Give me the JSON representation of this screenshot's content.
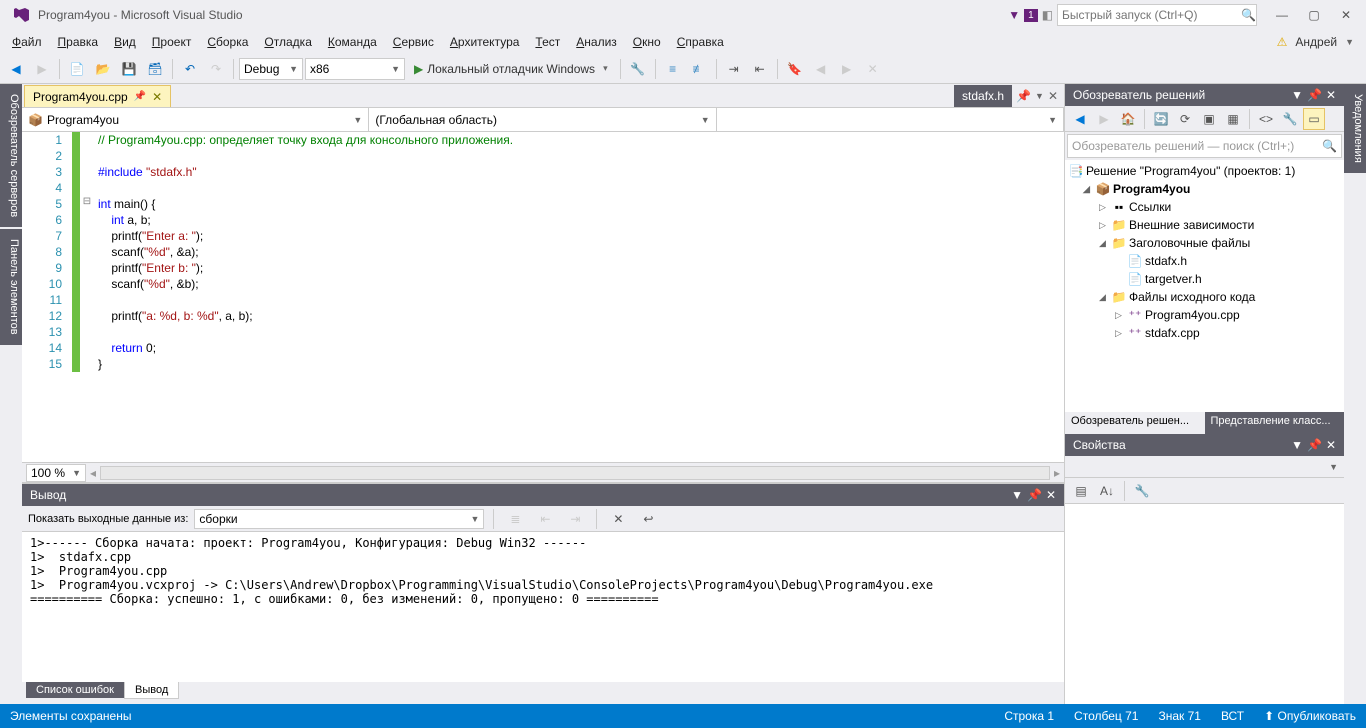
{
  "title": "Program4you - Microsoft Visual Studio",
  "notifCount": "1",
  "quickLaunch": "Быстрый запуск (Ctrl+Q)",
  "user": "Андрей",
  "menu": [
    "Файл",
    "Правка",
    "Вид",
    "Проект",
    "Сборка",
    "Отладка",
    "Команда",
    "Сервис",
    "Архитектура",
    "Тест",
    "Анализ",
    "Окно",
    "Справка"
  ],
  "toolbar": {
    "config": "Debug",
    "platform": "x86",
    "run": "Локальный отладчик Windows"
  },
  "leftStrips": [
    "Обозреватель серверов",
    "Панель элементов"
  ],
  "rightStrip": "Уведомления",
  "docTabs": {
    "active": "Program4you.cpp",
    "other": "stdafx.h"
  },
  "navCombos": {
    "left": "Program4you",
    "right": "(Глобальная область)"
  },
  "code": {
    "lines": [
      {
        "n": 1,
        "type": "cmt",
        "text": "// Program4you.cpp: определяет точку входа для консольного приложения."
      },
      {
        "n": 2,
        "type": "blank",
        "text": ""
      },
      {
        "n": 3,
        "type": "inc",
        "kw": "#include ",
        "str": "\"stdafx.h\""
      },
      {
        "n": 4,
        "type": "blank",
        "text": ""
      },
      {
        "n": 5,
        "type": "main",
        "pre": "",
        "kw1": "int",
        "mid": " main() {"
      },
      {
        "n": 6,
        "type": "decl",
        "indent": "    ",
        "kw": "int",
        "rest": " a, b;"
      },
      {
        "n": 7,
        "type": "call",
        "indent": "    ",
        "fn": "printf(",
        "str": "\"Enter a: \"",
        "end": ");"
      },
      {
        "n": 8,
        "type": "call",
        "indent": "    ",
        "fn": "scanf(",
        "str": "\"%d\"",
        "end": ", &a);"
      },
      {
        "n": 9,
        "type": "call",
        "indent": "    ",
        "fn": "printf(",
        "str": "\"Enter b: \"",
        "end": ");"
      },
      {
        "n": 10,
        "type": "call",
        "indent": "    ",
        "fn": "scanf(",
        "str": "\"%d\"",
        "end": ", &b);"
      },
      {
        "n": 11,
        "type": "blank",
        "text": ""
      },
      {
        "n": 12,
        "type": "call",
        "indent": "    ",
        "fn": "printf(",
        "str": "\"a: %d, b: %d\"",
        "end": ", a, b);"
      },
      {
        "n": 13,
        "type": "blank",
        "text": ""
      },
      {
        "n": 14,
        "type": "ret",
        "indent": "    ",
        "kw": "return",
        "rest": " 0;"
      },
      {
        "n": 15,
        "type": "txt",
        "text": "}"
      }
    ]
  },
  "zoom": "100 %",
  "output": {
    "title": "Вывод",
    "sourceLabel": "Показать выходные данные из:",
    "source": "сборки",
    "lines": [
      "1>------ Сборка начата: проект: Program4you, Конфигурация: Debug Win32 ------",
      "1>  stdafx.cpp",
      "1>  Program4you.cpp",
      "1>  Program4you.vcxproj -> C:\\Users\\Andrew\\Dropbox\\Programming\\VisualStudio\\ConsoleProjects\\Program4you\\Debug\\Program4you.exe",
      "========== Сборка: успешно: 1, с ошибками: 0, без изменений: 0, пропущено: 0 =========="
    ]
  },
  "bottomTabs": {
    "inactive": "Список ошибок",
    "active": "Вывод"
  },
  "solution": {
    "title": "Обозреватель решений",
    "searchPlaceholder": "Обозреватель решений — поиск (Ctrl+;)",
    "root": "Решение \"Program4you\" (проектов: 1)",
    "project": "Program4you",
    "refs": "Ссылки",
    "external": "Внешние зависимости",
    "headers": "Заголовочные файлы",
    "headerFiles": [
      "stdafx.h",
      "targetver.h"
    ],
    "sources": "Файлы исходного кода",
    "sourceFiles": [
      "Program4you.cpp",
      "stdafx.cpp"
    ],
    "tabs": {
      "active": "Обозреватель решен...",
      "inactive": "Представление класс..."
    }
  },
  "properties": {
    "title": "Свойства"
  },
  "status": {
    "left": "Элементы сохранены",
    "line": "Строка 1",
    "col": "Столбец 71",
    "char": "Знак 71",
    "ins": "ВСТ",
    "publish": "Опубликовать"
  }
}
